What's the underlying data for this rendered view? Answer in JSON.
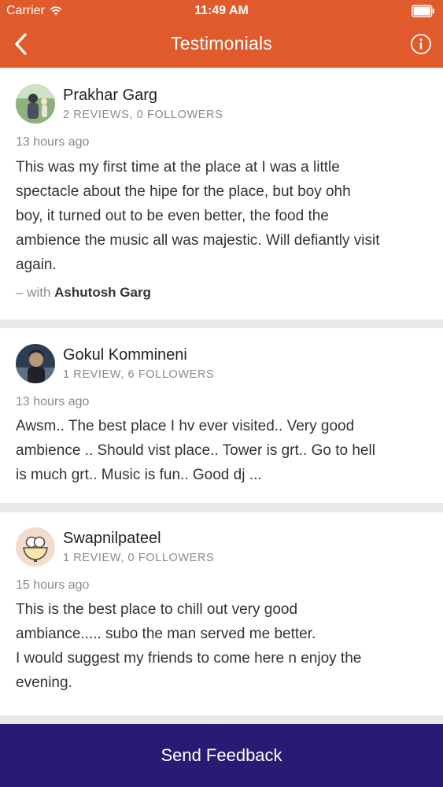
{
  "status_bar": {
    "carrier": "Carrier",
    "time": "11:49 AM"
  },
  "navbar": {
    "title": "Testimonials"
  },
  "testimonials": [
    {
      "name": "Prakhar Garg",
      "meta": "2 REVIEWS, 0 FOLLOWERS",
      "time_ago": "13 hours ago",
      "text_lines": [
        "This was my first time at the place at I was a little",
        "spectacle about the hipe for the place, but boy ohh",
        "boy, it turned out to be even better, the food the",
        "ambience the music all was majestic. Will defiantly visit",
        "again."
      ],
      "with_prefix": "– with",
      "with_name": "Ashutosh Garg"
    },
    {
      "name": "Gokul Kommineni",
      "meta": "1 REVIEW, 6 FOLLOWERS",
      "time_ago": "13 hours ago",
      "text_lines": [
        "Awsm.. The best place I hv ever visited.. Very good",
        "ambience .. Should vist place.. Tower is grt.. Go to hell",
        "is much grt.. Music is fun.. Good dj ..."
      ]
    },
    {
      "name": "Swapnilpateel",
      "meta": "1 REVIEW, 0 FOLLOWERS",
      "time_ago": "15 hours ago",
      "text_lines": [
        "This is the best place to chill out very good",
        "ambiance..... subo the man served me better.",
        "I would suggest my friends to come here n enjoy the",
        "evening."
      ]
    }
  ],
  "footer": {
    "button_label": "Send Feedback"
  },
  "colors": {
    "header": "#e05a2b",
    "footer": "#2b1a74"
  }
}
